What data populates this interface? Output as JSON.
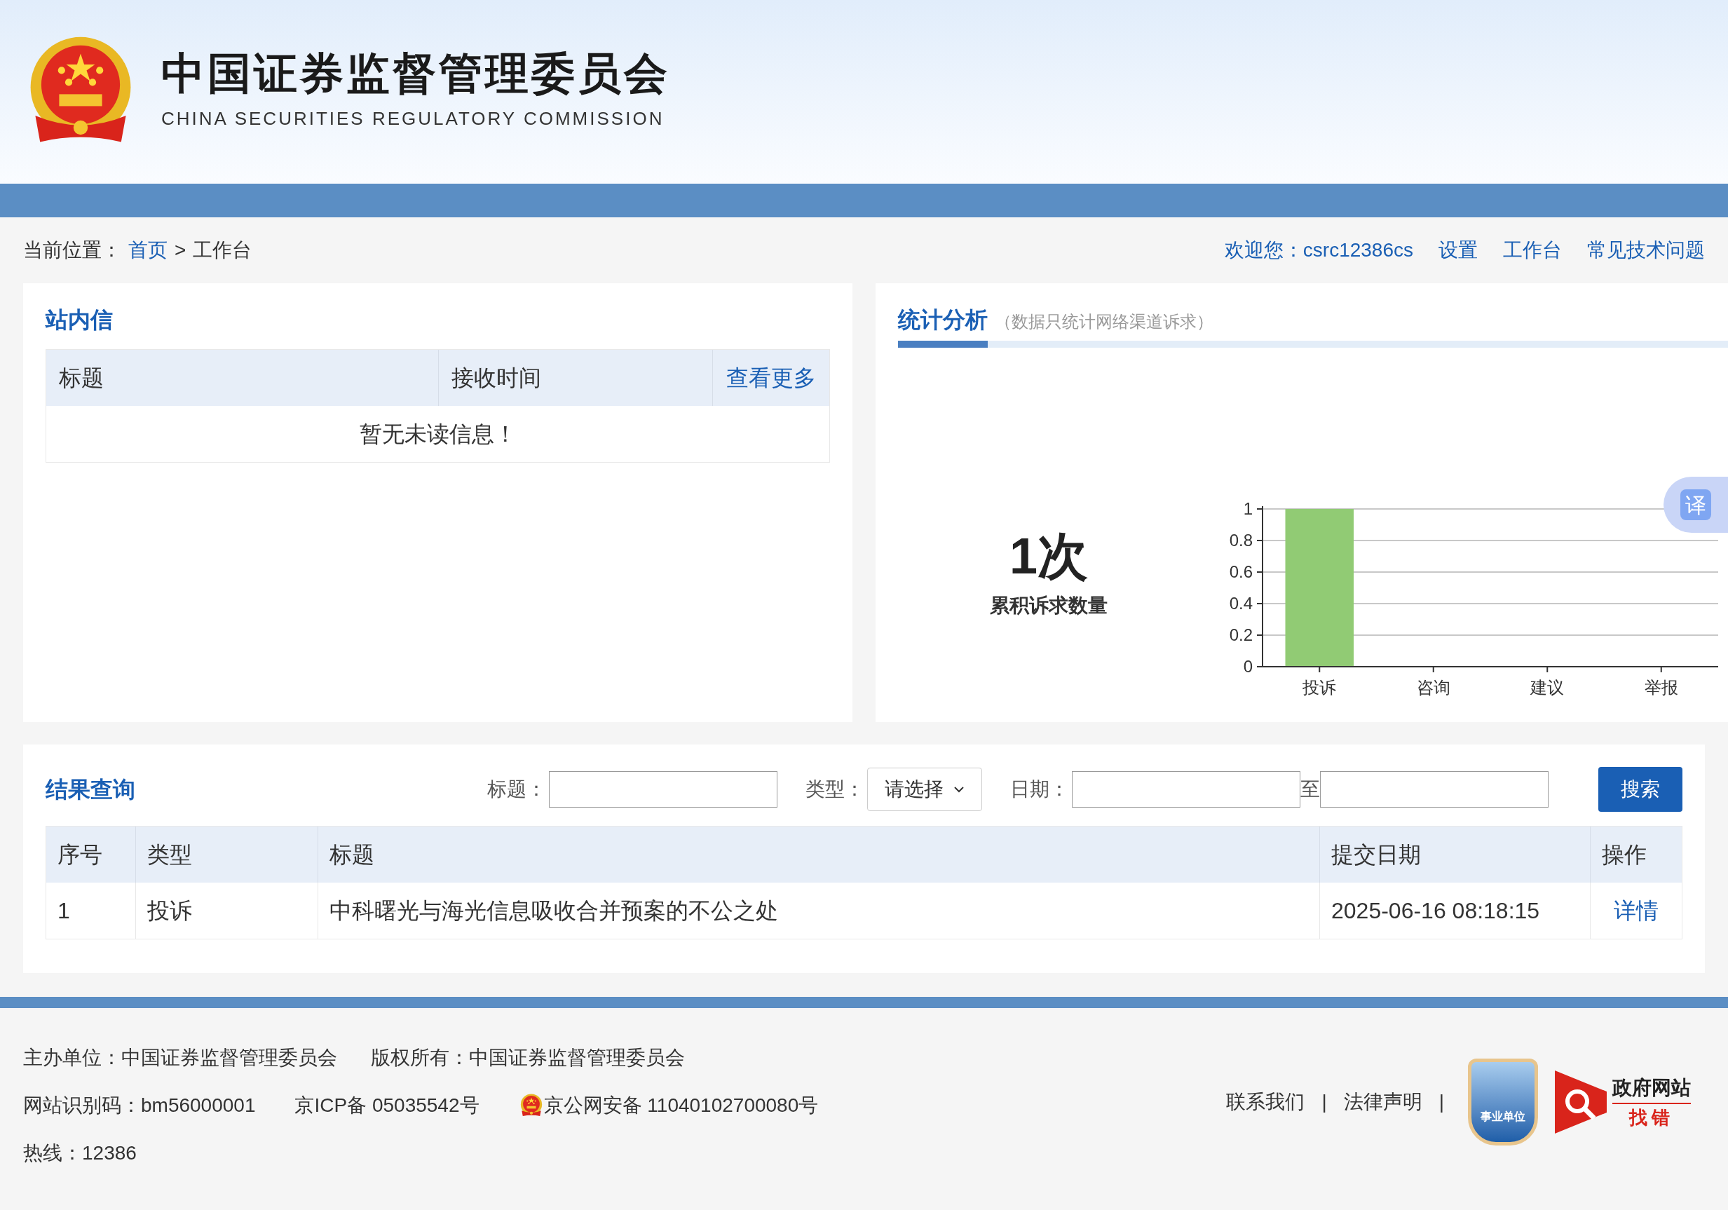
{
  "header": {
    "title": "中国证券监督管理委员会",
    "subtitle": "CHINA SECURITIES REGULATORY COMMISSION"
  },
  "breadcrumb": {
    "prefix": "当前位置：",
    "home": "首页",
    "separator": ">",
    "current": "工作台"
  },
  "user_nav": {
    "welcome": "欢迎您：csrc12386cs",
    "links": [
      "设置",
      "工作台",
      "常见技术问题"
    ]
  },
  "inbox": {
    "title": "站内信",
    "columns": [
      "标题",
      "接收时间"
    ],
    "more": "查看更多",
    "empty": "暂无未读信息！"
  },
  "stats": {
    "title": "统计分析",
    "note": "（数据只统计网络渠道诉求）",
    "total": "1次",
    "total_label": "累积诉求数量",
    "chart_data": {
      "type": "bar",
      "categories": [
        "投诉",
        "咨询",
        "建议",
        "举报"
      ],
      "series": [
        {
          "color": "#91cb74",
          "values": [
            1,
            0,
            0,
            0
          ]
        }
      ],
      "grid": true,
      "ylim": [
        0,
        1
      ],
      "yticks": [
        0,
        0.2,
        0.4,
        0.6,
        0.8,
        1
      ]
    }
  },
  "translate_button": "译",
  "results": {
    "title": "结果查询",
    "title_label": "标题：",
    "type_label": "类型：",
    "type_placeholder": "请选择",
    "date_label": "日期：",
    "date_separator": "至",
    "search_button": "搜索",
    "columns": [
      "序号",
      "类型",
      "标题",
      "提交日期",
      "操作"
    ],
    "rows": [
      {
        "index": "1",
        "type": "投诉",
        "title": "中科曙光与海光信息吸收合并预案的不公之处",
        "date": "2025-06-16 08:18:15",
        "action": "详情"
      }
    ]
  },
  "footer": {
    "sponsor": "主办单位：中国证券监督管理委员会",
    "copyright": "版权所有：中国证券监督管理委员会",
    "site_code": "网站识别码：bm56000001",
    "icp": "京ICP备 05035542号",
    "police": "京公网安备 11040102700080号",
    "hotline": "热线：12386",
    "links": [
      "联系我们",
      "法律声明"
    ],
    "separator": "|",
    "badge_text": "事业单位",
    "gov_title": "政府网站",
    "gov_subtitle": "找错"
  }
}
